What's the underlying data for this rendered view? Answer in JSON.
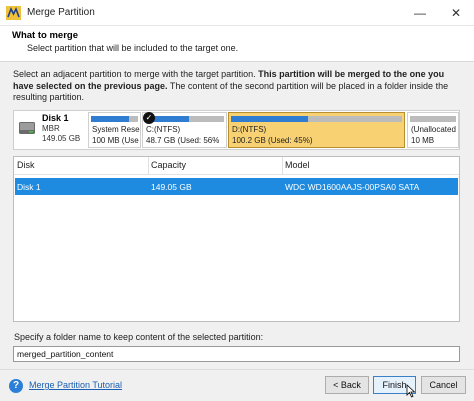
{
  "window": {
    "title": "Merge Partition"
  },
  "header": {
    "title": "What to merge",
    "subtitle": "Select partition that will be included to the target one."
  },
  "description": {
    "part1": "Select an adjacent partition to merge with the target partition. ",
    "bold": "This partition will be merged to the one you have selected on the previous page.",
    "part2": " The content of the second partition will be placed in a folder inside the resulting partition."
  },
  "disk_map": {
    "disk": {
      "name": "Disk 1",
      "type": "MBR",
      "size": "149.05 GB"
    },
    "partitions": [
      {
        "line1": "System Rese",
        "line2": "100 MB (Use",
        "usage": 0.8
      },
      {
        "line1": "C:(NTFS)",
        "line2": "48.7 GB (Used: 56%",
        "usage": 0.56,
        "checked": true
      },
      {
        "line1": "D:(NTFS)",
        "line2": "100.2 GB (Used: 45%)",
        "usage": 0.45,
        "selected": true
      },
      {
        "line1": "(Unallocated",
        "line2": "10 MB",
        "usage": 0
      }
    ]
  },
  "table": {
    "columns": [
      "Disk",
      "Capacity",
      "Model"
    ],
    "rows": [
      {
        "disk": "Disk 1",
        "capacity": "149.05 GB",
        "model": "WDC WD1600AAJS-00PSA0 SATA"
      }
    ]
  },
  "folder": {
    "label": "Specify a folder name to keep content of the selected partition:",
    "value": "merged_partition_content"
  },
  "footer": {
    "tutorial": "Merge Partition Tutorial",
    "back": "< Back",
    "finish": "Finish",
    "cancel": "Cancel"
  },
  "icons": {
    "app": "minitool-logo-icon",
    "minimize": "minimize-icon",
    "close": "close-icon",
    "disk": "hard-disk-icon",
    "check": "checkmark-icon",
    "help": "help-icon",
    "cursor": "mouse-cursor-icon"
  },
  "colors": {
    "selected_row": "#1e8be0",
    "selected_partition": "#f8d173",
    "usage_bar": "#2e7dd1",
    "link": "#1a5fb4"
  }
}
